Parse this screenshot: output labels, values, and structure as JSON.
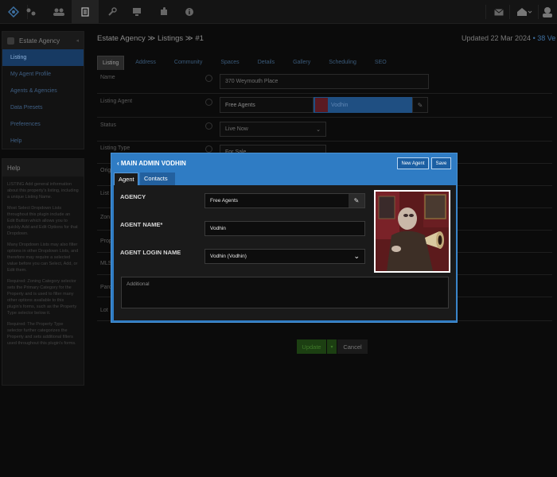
{
  "topbar": {
    "icons": [
      "logo-icon",
      "settings-icon",
      "users-icon",
      "document-icon",
      "wrench-icon",
      "monitor-icon",
      "puzzle-icon",
      "info-icon",
      "mail-icon",
      "home-icon",
      "user-menu-icon"
    ]
  },
  "sidebar": {
    "title": "Estate Agency",
    "items": [
      "Listing",
      "My Agent Profile",
      "Agents & Agencies",
      "Data Presets",
      "Preferences",
      "Help"
    ]
  },
  "help": {
    "title": "Help",
    "paragraphs": [
      "LISTING Add general information about this property's listing, including a unique Listing Name.",
      "Most Select Dropdown Lists throughout this plugin include an Edit Button which allows you to quickly Add and Edit Options for that Dropdown.",
      "Many Dropdown Lists may also filter options in other Dropdown Lists, and therefore may require a selected value before you can Select, Add, or Edit them.",
      "Required: Zoning Category selector sets the Primary Category for the Property and is used to filter many other options available to this plugin's forms, such as the Property Type selector below it.",
      "Required: The Property Type selector further categorizes the Property and sets additional filters used throughout this plugin's forms."
    ]
  },
  "header": {
    "breadcrumb": "Estate Agency ≫ Listings ≫ #1",
    "updated": "Updated 22 Mar 2024",
    "updated_extra": "• 38 Ve"
  },
  "tabs": [
    "Listing",
    "Address",
    "Community",
    "Spaces",
    "Details",
    "Gallery",
    "Scheduling",
    "SEO"
  ],
  "form": {
    "name_label": "Name",
    "name_value": "370 Weymouth Place",
    "agent_label": "Listing Agent",
    "agency_value": "Free Agents",
    "agent_value": "Vodhin",
    "status_label": "Status",
    "status_value": "Live Now",
    "type_label": "Listing Type",
    "type_value": "For Sale",
    "hidden_labels": [
      "Orig",
      "List",
      "Zon",
      "Prop",
      "MLS",
      "Parc",
      "Lot"
    ],
    "update_label": "Update",
    "cancel_label": "Cancel"
  },
  "modal": {
    "title": "MAIN ADMIN VODHIN",
    "new_agent_label": "New Agent",
    "save_label": "Save",
    "tabs": [
      "Agent",
      "Contacts"
    ],
    "agency_label": "AGENCY",
    "agency_value": "Free Agents",
    "agent_name_label": "AGENT NAME*",
    "agent_name_value": "Vodhin",
    "login_label": "AGENT LOGIN NAME",
    "login_value": "Vodhin (Vodhin)",
    "additional_placeholder": "Additional"
  },
  "colors": {
    "accent": "#2f7cc4",
    "active_nav": "#173a63",
    "update_green": "#1c3f12"
  }
}
